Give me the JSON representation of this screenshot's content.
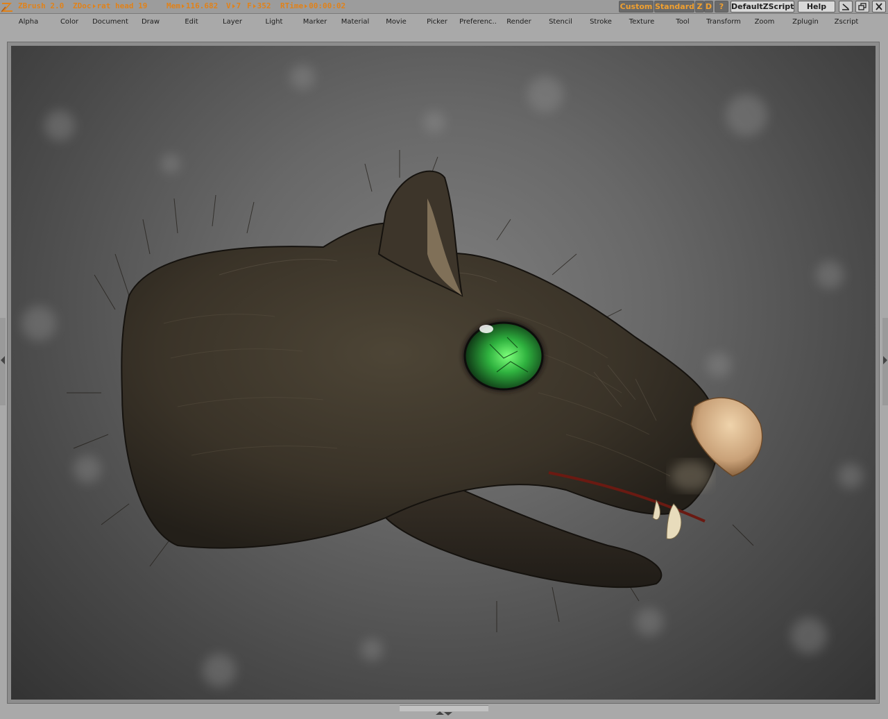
{
  "titlebar": {
    "app": "ZBrush 2.0",
    "zdoc_label": "ZDoc",
    "doc_name": "rat head 19",
    "mem_label": "Mem",
    "mem_value": "116.682",
    "v_label": "V",
    "v_value": "7",
    "f_label": "F",
    "f_value": "352",
    "rtime_label": "RTime",
    "rtime_value": "00:00:02",
    "buttons": {
      "custom": "Custom",
      "standard": "Standard",
      "z": "Z",
      "d": "D",
      "help_q": "?",
      "script": "DefaultZScript",
      "help": "Help"
    }
  },
  "menu": [
    "Alpha",
    "Color",
    "Document",
    "Draw",
    "Edit",
    "Layer",
    "Light",
    "Marker",
    "Material",
    "Movie",
    "Picker",
    "Preferenc..",
    "Render",
    "Stencil",
    "Stroke",
    "Texture",
    "Tool",
    "Transform",
    "Zoom",
    "Zplugin",
    "Zscript"
  ],
  "colors": {
    "accent_orange": "#e0821a",
    "chrome_gray": "#a9a9a9",
    "eye_green": "#3fcc55",
    "fur_dark": "#3a3328",
    "nose_beige": "#d8b88e"
  },
  "icons": {
    "logo": "zbrush-logo-icon",
    "minimize": "minimize-icon",
    "restore": "restore-icon",
    "close": "close-icon"
  }
}
